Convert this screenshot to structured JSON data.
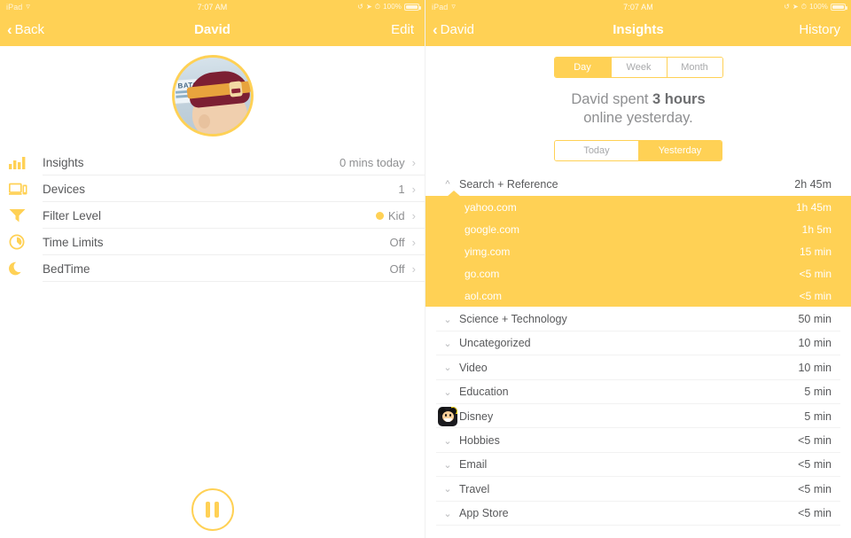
{
  "colors": {
    "accent": "#ffd155",
    "text": "#58595b",
    "muted": "#8e8f91"
  },
  "left": {
    "statusbar": {
      "device": "iPad",
      "wifi": "wifi-icon",
      "time": "7:07 AM",
      "battery_percent": "100%"
    },
    "navbar": {
      "back_label": "Back",
      "title": "David",
      "right_label": "Edit"
    },
    "avatar": {
      "name": "david-avatar"
    },
    "rows": [
      {
        "icon": "bar-chart-icon",
        "label": "Insights",
        "value": "0 mins today",
        "chevron": "›"
      },
      {
        "icon": "devices-icon",
        "label": "Devices",
        "value": "1",
        "chevron": "›"
      },
      {
        "icon": "filter-funnel-icon",
        "label": "Filter Level",
        "value": "Kid",
        "dot": true,
        "chevron": "›"
      },
      {
        "icon": "clock-icon",
        "label": "Time Limits",
        "value": "Off",
        "chevron": "›"
      },
      {
        "icon": "moon-icon",
        "label": "BedTime",
        "value": "Off",
        "chevron": "›"
      }
    ],
    "pause_button": "pause-button"
  },
  "right": {
    "statusbar": {
      "device": "iPad",
      "wifi": "wifi-icon",
      "time": "7:07 AM",
      "battery_percent": "100%"
    },
    "navbar": {
      "back_label": "David",
      "title": "Insights",
      "right_label": "History"
    },
    "range_segments": [
      {
        "label": "Day",
        "selected": true
      },
      {
        "label": "Week",
        "selected": false
      },
      {
        "label": "Month",
        "selected": false
      }
    ],
    "summary": {
      "prefix": "David spent ",
      "amount": "3 hours",
      "suffix": "online yesterday."
    },
    "day_segments": [
      {
        "label": "Today",
        "selected": false
      },
      {
        "label": "Yesterday",
        "selected": true
      }
    ],
    "categories": [
      {
        "name": "Search + Reference",
        "time": "2h 45m",
        "expanded": true,
        "icon": "chevron-up-icon",
        "sites": [
          {
            "name": "yahoo.com",
            "time": "1h 45m"
          },
          {
            "name": "google.com",
            "time": "1h 5m"
          },
          {
            "name": "yimg.com",
            "time": "15 min"
          },
          {
            "name": "go.com",
            "time": "<5 min"
          },
          {
            "name": "aol.com",
            "time": "<5 min"
          }
        ]
      },
      {
        "name": "Science + Technology",
        "time": "50 min",
        "expanded": false,
        "icon": "chevron-down-icon"
      },
      {
        "name": "Uncategorized",
        "time": "10 min",
        "expanded": false,
        "icon": "chevron-down-icon"
      },
      {
        "name": "Video",
        "time": "10 min",
        "expanded": false,
        "icon": "chevron-down-icon"
      },
      {
        "name": "Education",
        "time": "5 min",
        "expanded": false,
        "icon": "chevron-down-icon"
      },
      {
        "name": "Disney",
        "time": "5 min",
        "expanded": false,
        "icon": "disney-app-icon"
      },
      {
        "name": "Hobbies",
        "time": "<5 min",
        "expanded": false,
        "icon": "chevron-down-icon"
      },
      {
        "name": "Email",
        "time": "<5 min",
        "expanded": false,
        "icon": "chevron-down-icon"
      },
      {
        "name": "Travel",
        "time": "<5 min",
        "expanded": false,
        "icon": "chevron-down-icon"
      },
      {
        "name": "App Store",
        "time": "<5 min",
        "expanded": false,
        "icon": "chevron-down-icon"
      }
    ]
  }
}
